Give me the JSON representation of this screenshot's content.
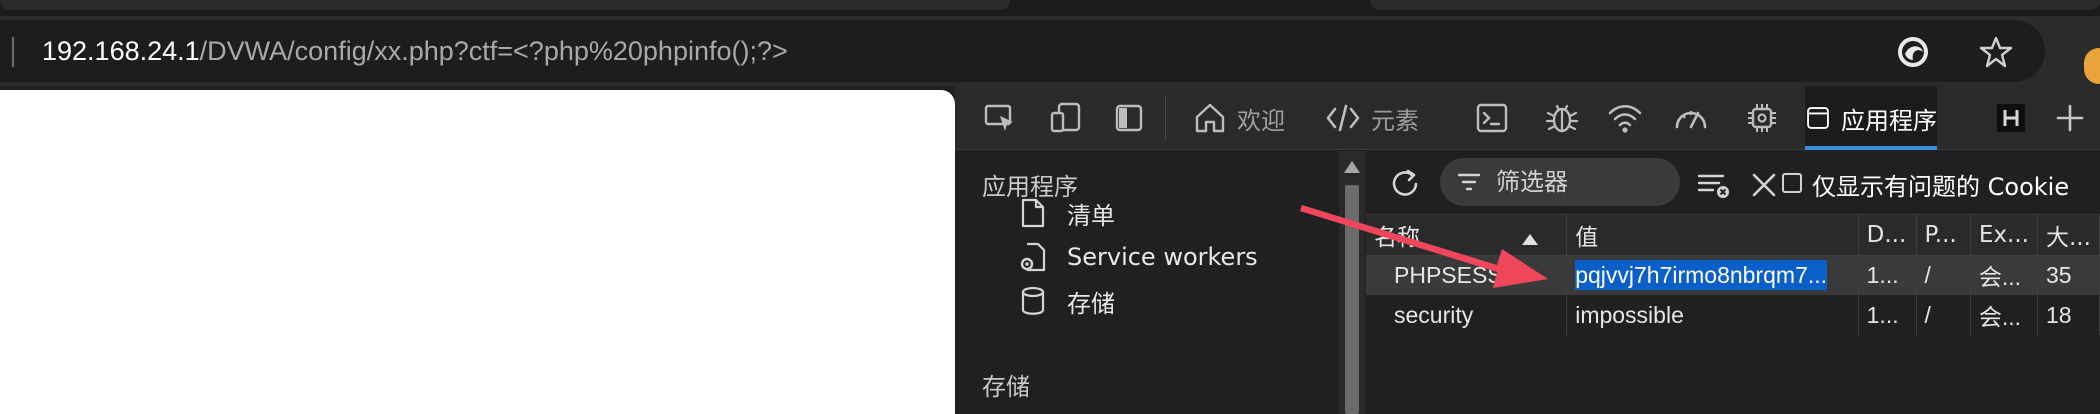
{
  "browser": {
    "url_host": "192.168.24.1",
    "url_path": "/DVWA/config/xx.php?ctf=<?php%20phpinfo();?>",
    "icons": [
      "edge-copilot-icon",
      "favorite-star-icon",
      "extension-icon"
    ]
  },
  "devtools": {
    "tabs": [
      {
        "name": "inspect-icon"
      },
      {
        "name": "device-emulation-icon"
      },
      {
        "name": "toggle-sidebar-icon"
      },
      {
        "icon": "home-icon",
        "label": "欢迎"
      },
      {
        "icon": "code-icon",
        "label": "元素"
      },
      {
        "name": "console-icon"
      },
      {
        "name": "bug-icon"
      },
      {
        "name": "network-wifi-icon"
      },
      {
        "name": "performance-gauge-icon"
      },
      {
        "name": "memory-chip-icon"
      },
      {
        "icon": "application-icon",
        "label": "应用程序",
        "active": true
      },
      {
        "name": "hackbar-icon"
      },
      {
        "name": "add-tab-icon"
      }
    ],
    "sidebar": {
      "section_app": "应用程序",
      "items": [
        {
          "icon": "file-icon",
          "label": "清单"
        },
        {
          "icon": "gear-file-icon",
          "label": "Service workers"
        },
        {
          "icon": "database-icon",
          "label": "存储"
        }
      ],
      "section_storage": "存储"
    },
    "cookies": {
      "filter_placeholder": "筛选器",
      "only_issues_label": "仅显示有问题的 Cookie",
      "columns": [
        "名称",
        "值",
        "D...",
        "P...",
        "Ex...",
        "大..."
      ],
      "rows": [
        {
          "name": "PHPSESSID",
          "value": "pqjvvj7h7irmo8nbrqm7...",
          "domain": "1...",
          "path": "/",
          "expires": "会...",
          "size": "35"
        },
        {
          "name": "security",
          "value": "impossible",
          "domain": "1...",
          "path": "/",
          "expires": "会...",
          "size": "18"
        }
      ]
    }
  },
  "colors": {
    "accent": "#3b8fe0",
    "selection": "#0a5fc9",
    "annotation_arrow": "#f0465c"
  }
}
